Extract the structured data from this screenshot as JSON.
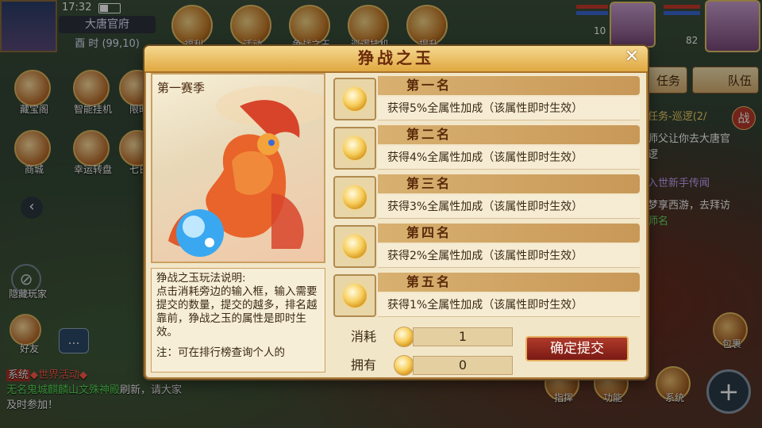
{
  "status": {
    "time": "17:32"
  },
  "map": {
    "name": "大唐官府",
    "coord": "酉 时 (99,10)"
  },
  "top_icons": [
    {
      "label": "福利"
    },
    {
      "label": "活动"
    },
    {
      "label": "争战之玉"
    },
    {
      "label": "巡逻挂机"
    },
    {
      "label": "提升"
    }
  ],
  "player": {
    "level_a": "10",
    "level_b": "82"
  },
  "left_icons": [
    {
      "label": "藏宝阁"
    },
    {
      "label": "智能挂机"
    },
    {
      "label": "限时"
    },
    {
      "label": "商城"
    },
    {
      "label": "幸运转盘"
    },
    {
      "label": "七日"
    }
  ],
  "hide_players": "隐藏玩家",
  "friend": "好友",
  "right_tabs": {
    "task": "任务",
    "team": "队伍"
  },
  "tasks": [
    {
      "text": "任务-巡逻(2/",
      "color": "#f5d36a"
    },
    {
      "text": "师父让你去大唐官",
      "color": "#ffffff"
    },
    {
      "text": "逻",
      "color": "#ffffff"
    },
    {
      "text": "入世新手传闻",
      "color": "#c7a4ff"
    },
    {
      "text": "梦享西游，去拜访",
      "color": "#ffffff"
    },
    {
      "text": "师名",
      "color": "#6ae06a"
    }
  ],
  "battle_icon": "战",
  "right_buttons": {
    "bag": "包裹",
    "func": "功能",
    "system": "系统",
    "guide": "指挥"
  },
  "chat": {
    "line1_tag": "系统",
    "line1": "◆世界活动◆",
    "line2_a": "无名鬼城",
    "line2_b": "麒麟山",
    "line2_c": "文殊神殿",
    "line2_d": "刷新，请大家",
    "line3": "及时参加！"
  },
  "dialog": {
    "title": "狰战之玉",
    "season_label": "第一赛季",
    "desc_title": "狰战之玉玩法说明:",
    "desc_body": "点击消耗旁边的输入框，输入需要提交的数量，提交的越多，排名越靠前，狰战之玉的属性是即时生效。",
    "note": "注：可在排行榜查询个人的",
    "ranks": [
      {
        "name": "第一名",
        "reward": "获得5%全属性加成（该属性即时生效）"
      },
      {
        "name": "第二名",
        "reward": "获得4%全属性加成（该属性即时生效）"
      },
      {
        "name": "第三名",
        "reward": "获得3%全属性加成（该属性即时生效）"
      },
      {
        "name": "第四名",
        "reward": "获得2%全属性加成（该属性即时生效）"
      },
      {
        "name": "第五名",
        "reward": "获得1%全属性加成（该属性即时生效）"
      }
    ],
    "cost_label": "消耗",
    "cost_value": "1",
    "own_label": "拥有",
    "own_value": "0",
    "submit_label": "确定提交"
  }
}
